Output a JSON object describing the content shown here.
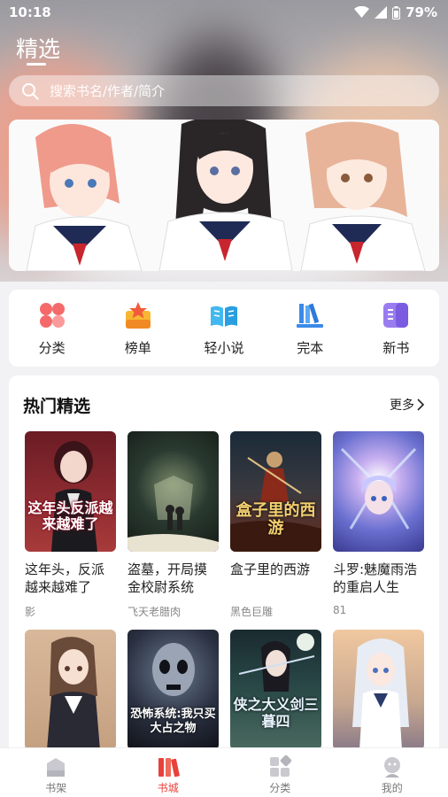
{
  "status": {
    "time": "10:18",
    "battery": "79%"
  },
  "header": {
    "title": "精选"
  },
  "search": {
    "placeholder": "搜索书名/作者/简介"
  },
  "quick_nav": [
    {
      "label": "分类",
      "icon": "category-icon",
      "color": "#f25a5a"
    },
    {
      "label": "榜单",
      "icon": "ranking-icon",
      "color": "#f5a623"
    },
    {
      "label": "轻小说",
      "icon": "light-novel-icon",
      "color": "#3aa7e8"
    },
    {
      "label": "完本",
      "icon": "completed-icon",
      "color": "#3a8ae8"
    },
    {
      "label": "新书",
      "icon": "new-book-icon",
      "color": "#8a6ae8"
    }
  ],
  "hot": {
    "title": "热门精选",
    "more": "更多",
    "books": [
      {
        "name": "这年头，反派越来越难了",
        "author": "影",
        "cover_text": "这年头反派越来越难了"
      },
      {
        "name": "盗墓，开局摸金校尉系统",
        "author": "飞天老腊肉",
        "cover_text": ""
      },
      {
        "name": "盒子里的西游",
        "author": "黑色巨雕",
        "cover_text": "盒子里的西游"
      },
      {
        "name": "斗罗:魅魔雨浩的重启人生",
        "author": "81",
        "cover_text": ""
      },
      {
        "name": "",
        "author": "",
        "cover_text": ""
      },
      {
        "name": "",
        "author": "",
        "cover_text": "恐怖系统:我只买大占之物"
      },
      {
        "name": "",
        "author": "",
        "cover_text": "侠之大义剑三暮四"
      },
      {
        "name": "",
        "author": "",
        "cover_text": ""
      }
    ]
  },
  "bottom_nav": [
    {
      "label": "书架",
      "icon": "bookshelf-icon",
      "active": false
    },
    {
      "label": "书城",
      "icon": "bookstore-icon",
      "active": true
    },
    {
      "label": "分类",
      "icon": "category-tab-icon",
      "active": false
    },
    {
      "label": "我的",
      "icon": "profile-icon",
      "active": false
    }
  ],
  "colors": {
    "accent": "#e8413b"
  }
}
